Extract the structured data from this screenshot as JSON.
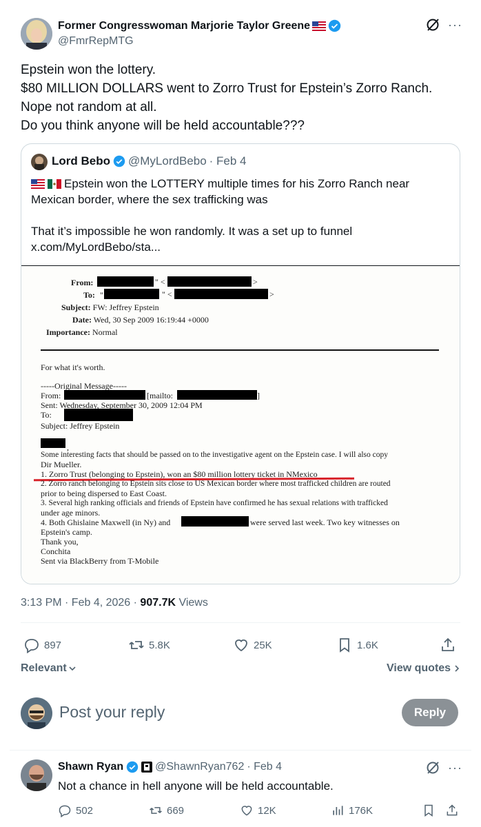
{
  "main_tweet": {
    "author_name": "Former Congresswoman Marjorie Taylor Greene",
    "author_handle": "@FmrRepMTG",
    "text_lines": [
      "Epstein won the lottery.",
      "$80 MILLION DOLLARS went to Zorro Trust for Epstein’s Zorro Ranch.",
      "Nope not random at all.",
      "Do you think anyone will be held accountable???"
    ],
    "timestamp": "3:13 PM · Feb 4, 2026 · ",
    "views_count": "907.7K",
    "views_label": " Views",
    "replies": "897",
    "reposts": "5.8K",
    "likes": "25K",
    "bookmarks": "1.6K"
  },
  "quoted_tweet": {
    "author_name": "Lord Bebo",
    "author_handle": "@MyLordBebo",
    "date": "· Feb 4",
    "line1": "Epstein won the LOTTERY multiple times for his Zorro Ranch near",
    "line2": "Mexican border, where the sex trafficking was",
    "line3": "That it’s impossible he won randomly. It was a set up to funnel",
    "line4": "x.com/MyLordBebo/sta..."
  },
  "document": {
    "from_label": "From:",
    "to_label": "To:",
    "subject_label": "Subject:",
    "subject_value": "FW: Jeffrey Epstein",
    "date_label": "Date:",
    "date_value": "Wed, 30 Sep 2009 16:19:44 +0000",
    "importance_label": "Importance:",
    "importance_value": "Normal",
    "worth": "For what it's worth.",
    "original": "-----Original Message-----",
    "from2": "From:",
    "mailto": "[mailto:",
    "sent": "Sent: Wednesday, September 30, 2009 12:04 PM",
    "to2": "To:",
    "subject2": "Subject: Jeffrey Epstein",
    "body_lines": [
      "Some interesting facts that should be passed on to the investigative agent on the Epstein case. I will also copy",
      "Dir Mueller.",
      "1. Zorro Trust (belonging to Epstein), won an $80 million lottery ticket in NMexico",
      "2. Zorro ranch belonging to Epstein sits close to US Mexican border where most trafficked children are routed",
      "prior to being dispersed to East Coast.",
      "3. Several high ranking officials and friends of Epstein have confirmed he has sexual relations with trafficked",
      "under age minors.",
      "4. Both Ghislaine Maxwell (in Ny) and"
    ],
    "witness_tail": "were served last week. Two key witnesses on",
    "closing_lines": [
      "Epstein's camp.",
      "Thank you,",
      "Conchita",
      "Sent via BlackBerry from T-Mobile"
    ]
  },
  "sort": {
    "relevant": "Relevant",
    "view_quotes": "View quotes"
  },
  "compose": {
    "placeholder": "Post your reply",
    "reply_button": "Reply"
  },
  "reply": {
    "author_name": "Shawn Ryan",
    "author_handle": "@ShawnRyan762",
    "date": "· Feb 4",
    "text": "Not a chance in hell anyone will be held accountable.",
    "replies": "502",
    "reposts": "669",
    "likes": "12K",
    "views": "176K"
  },
  "colors": {
    "verified_blue": "#1d9bf0",
    "muted_text": "#536471",
    "reply_button_bg": "#8b9196",
    "underline_red": "#d8232a"
  }
}
